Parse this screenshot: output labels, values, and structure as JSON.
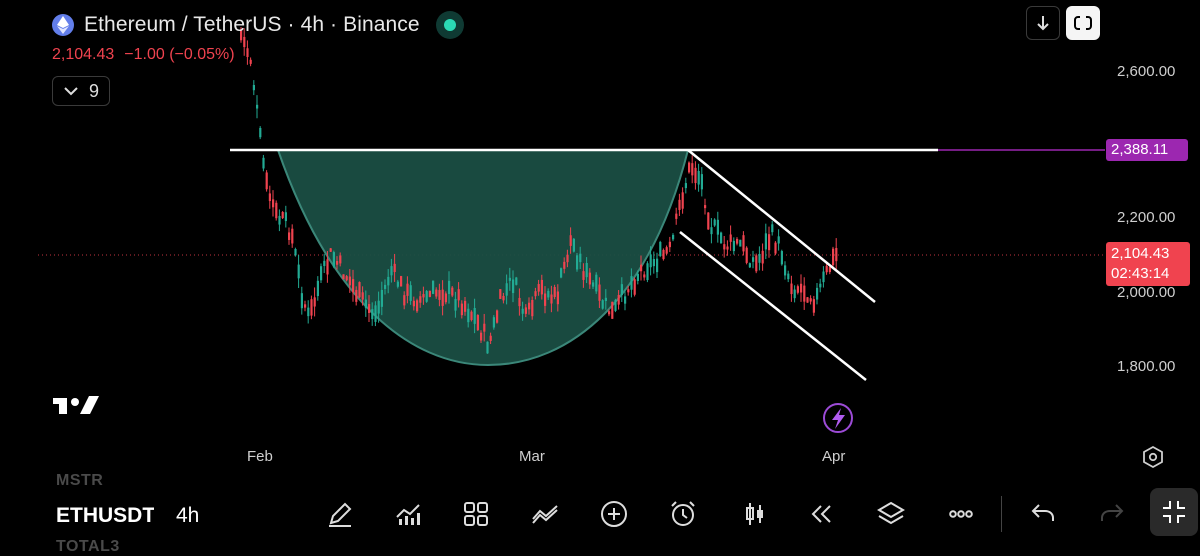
{
  "header": {
    "title": "Ethereum / TetherUS · 4h · Binance",
    "last_price": "2,104.43",
    "change": "−1.00 (−0.05%)",
    "indicators_count": "9"
  },
  "price_axis": {
    "labels": [
      "2,600.00",
      "2,200.00",
      "2,000.00",
      "1,800.00"
    ],
    "level_tag": "2,388.11",
    "current_price_tag": "2,104.43",
    "countdown": "02:43:14"
  },
  "time_axis": {
    "labels": [
      "Feb",
      "Mar",
      "Apr"
    ]
  },
  "bottom_bar": {
    "symbol_above": "MSTR",
    "current_symbol": "ETHUSDT",
    "interval": "4h",
    "symbol_below": "TOTAL3",
    "tools": [
      "drawing-tools",
      "indicators",
      "layouts",
      "compare",
      "add",
      "alerts",
      "chart-type",
      "replay",
      "objects-tree",
      "more",
      "undo",
      "redo",
      "fullscreen"
    ]
  },
  "colors": {
    "background": "#000000",
    "down": "#f0434f",
    "up": "#22ab94",
    "cup_fill": "#1b4f44",
    "level_tag": "#9c27b0",
    "status": "#2bd9b4"
  }
}
